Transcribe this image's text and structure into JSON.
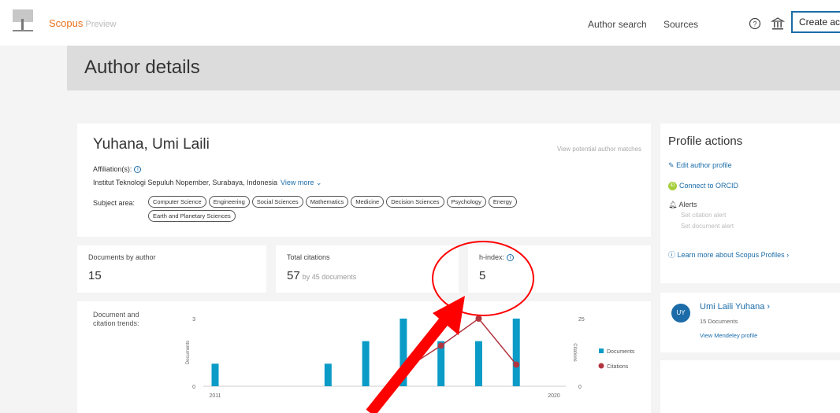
{
  "header": {
    "brand": "Scopus",
    "brand_sub": "Preview",
    "nav": [
      "Author search",
      "Sources"
    ],
    "create_button": "Create account"
  },
  "page_title": "Author details",
  "author": {
    "name": "Yuhana, Umi Laili",
    "potential_link": "View potential author matches",
    "affiliation_label": "Affiliation(s):",
    "affiliation": "Institut Teknologi Sepuluh Nopember, Surabaya, Indonesia",
    "view_more": "View more",
    "subject_label": "Subject area:",
    "subjects": [
      "Computer Science",
      "Engineering",
      "Social Sciences",
      "Mathematics",
      "Medicine",
      "Decision Sciences",
      "Psychology",
      "Energy",
      "Earth and Planetary Sciences"
    ]
  },
  "metrics": {
    "docs_label": "Documents by author",
    "docs_value": "15",
    "cit_label": "Total citations",
    "cit_value": "57",
    "cit_sub": "by 45 documents",
    "h_label": "h-index:",
    "h_value": "5"
  },
  "trend": {
    "title": "Document and citation trends:",
    "legend_docs": "Documents",
    "legend_cit": "Citations"
  },
  "profile_actions": {
    "title": "Profile actions",
    "edit": "Edit author profile",
    "orcid": "Connect to ORCID",
    "alerts": "Alerts",
    "set_citation": "Set citation alert",
    "set_document": "Set document alert",
    "learn": "Learn more about Scopus Profiles"
  },
  "mendeley": {
    "initials": "UY",
    "name": "Umi Laili Yuhana",
    "docs": "15 Documents",
    "link": "View Mendeley profile"
  },
  "colors": {
    "accent": "#1b6ca8",
    "brand": "#e9711c",
    "bar": "#0b9bc7",
    "citation": "#b2353f",
    "annotation": "#ff0000"
  },
  "chart_data": {
    "type": "bar",
    "title": "Document and citation trends:",
    "x_tick_labels": [
      "2011",
      "2020"
    ],
    "years": [
      2011,
      2012,
      2013,
      2014,
      2015,
      2016,
      2017,
      2018,
      2019,
      2020
    ],
    "y_left_label": "Documents",
    "y_left_ticks": [
      "0",
      "3"
    ],
    "y_left_lim": [
      0,
      3
    ],
    "y_right_label": "Citations",
    "y_right_ticks": [
      "0",
      "25"
    ],
    "y_right_lim": [
      0,
      25
    ],
    "series": [
      {
        "name": "Documents",
        "kind": "bar",
        "values": [
          1,
          0,
          0,
          1,
          2,
          3,
          2,
          2,
          3,
          0
        ]
      },
      {
        "name": "Citations",
        "kind": "line",
        "values": [
          null,
          null,
          null,
          null,
          null,
          6,
          15,
          25,
          8,
          null
        ]
      }
    ]
  }
}
